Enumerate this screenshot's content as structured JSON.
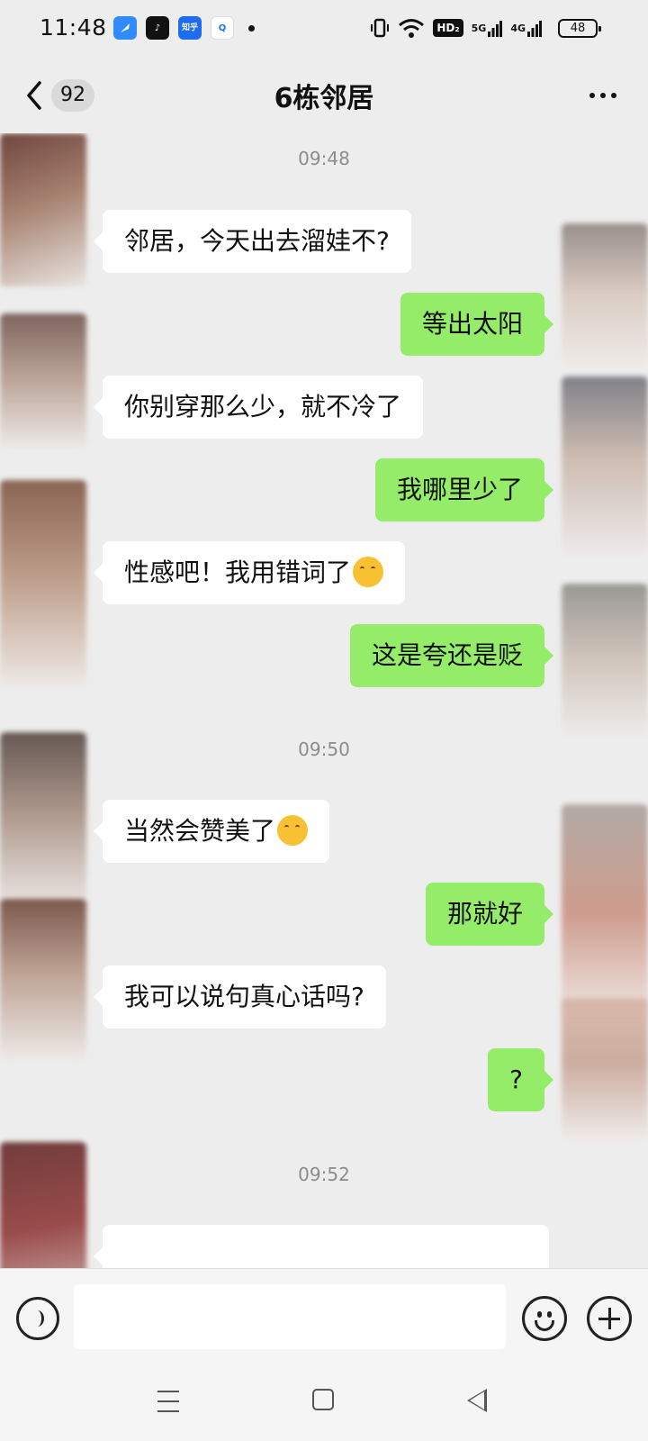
{
  "status_bar": {
    "time": "11:48",
    "apps": [
      {
        "icon": "feather-app-icon",
        "label": ""
      },
      {
        "icon": "tiktok-icon",
        "label": "♪"
      },
      {
        "icon": "zhihu-icon",
        "label": "知乎"
      },
      {
        "icon": "search-app-icon",
        "label": "Q"
      }
    ],
    "hd_label": "HD₂",
    "net1": "5G",
    "net2": "4G",
    "battery": "48"
  },
  "header": {
    "unread_count": "92",
    "title": "6栋邻居"
  },
  "messages": [
    {
      "type": "time",
      "text": "09:48"
    },
    {
      "type": "in",
      "text": "邻居，今天出去溜娃不?"
    },
    {
      "type": "out",
      "text": "等出太阳"
    },
    {
      "type": "in",
      "text": "你别穿那么少，就不冷了"
    },
    {
      "type": "out",
      "text": "我哪里少了"
    },
    {
      "type": "in",
      "text": "性感吧！我用错词了",
      "emoji": "thinking-emoji"
    },
    {
      "type": "out",
      "text": "这是夸还是贬"
    },
    {
      "type": "time",
      "text": "09:50"
    },
    {
      "type": "in",
      "text": "当然会赞美了",
      "emoji": "thinking-emoji"
    },
    {
      "type": "out",
      "text": "那就好"
    },
    {
      "type": "in",
      "text": "我可以说句真心话吗?"
    },
    {
      "type": "out",
      "text": "?"
    },
    {
      "type": "time",
      "text": "09:52"
    }
  ],
  "colors": {
    "background": "#ededed",
    "outgoing_bubble": "#95ec69",
    "incoming_bubble": "#ffffff",
    "timestamp": "#8c8c8c"
  }
}
